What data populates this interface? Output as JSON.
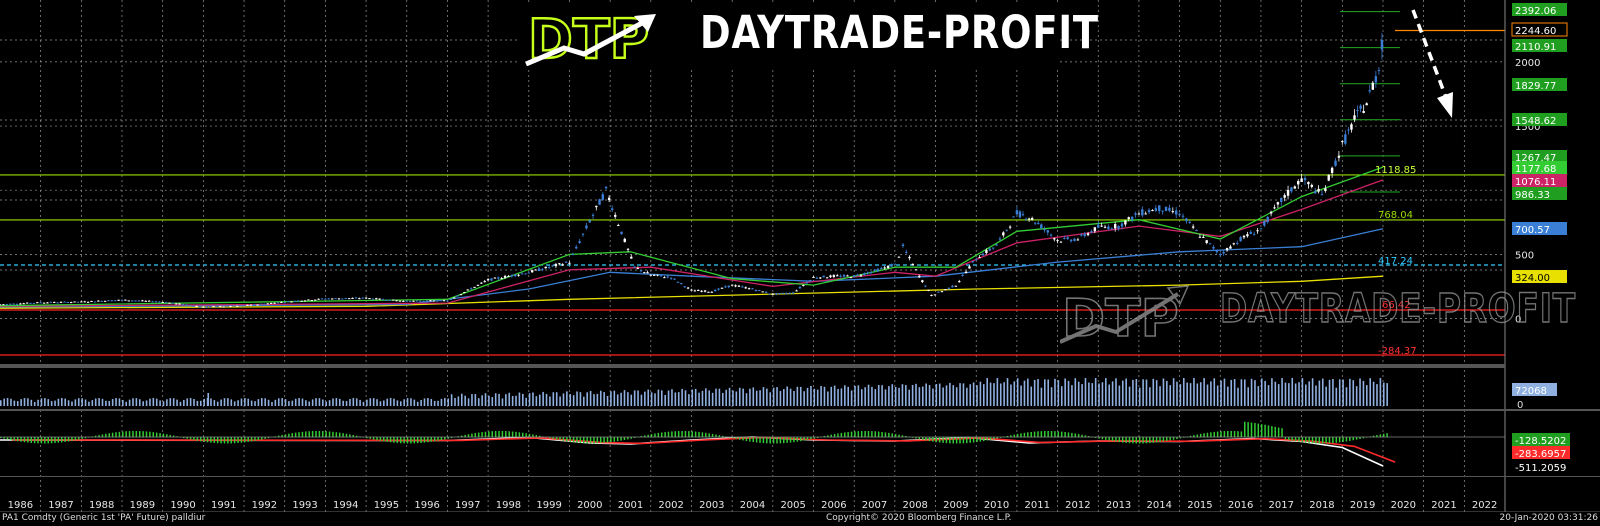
{
  "chart_data": {
    "type": "line",
    "instrument": "PA1 Comdty (Generic 1st 'PA' Future) palldiur",
    "x_ticks": [
      "1986",
      "1987",
      "1988",
      "1989",
      "1990",
      "1991",
      "1992",
      "1993",
      "1994",
      "1995",
      "1996",
      "1997",
      "1998",
      "1999",
      "2000",
      "2001",
      "2002",
      "2003",
      "2004",
      "2005",
      "2006",
      "2007",
      "2008",
      "2009",
      "2010",
      "2011",
      "2012",
      "2013",
      "2014",
      "2015",
      "2016",
      "2017",
      "2018",
      "2019",
      "2020",
      "2021",
      "2022"
    ],
    "y_ticks": [
      {
        "value": 2000,
        "label": "2000"
      },
      {
        "value": 1500,
        "label": "1500"
      },
      {
        "value": 500,
        "label": "500"
      },
      {
        "value": 0,
        "label": "0"
      }
    ],
    "price_series": {
      "name": "Palladium monthly",
      "x": [
        1986,
        1987,
        1988,
        1989,
        1990,
        1991,
        1992,
        1993,
        1994,
        1995,
        1996,
        1997,
        1998,
        1999,
        2000,
        2000.5,
        2000.9,
        2001.2,
        2001.6,
        2002,
        2002.5,
        2003,
        2003.5,
        2004,
        2004.5,
        2005,
        2005.5,
        2006,
        2006.5,
        2007,
        2007.5,
        2008,
        2008.2,
        2008.6,
        2008.9,
        2009.5,
        2010,
        2010.5,
        2011,
        2011.3,
        2011.6,
        2012,
        2012.5,
        2013,
        2013.5,
        2014,
        2014.5,
        2015,
        2015.5,
        2016,
        2016.5,
        2017,
        2017.5,
        2018,
        2018.5,
        2019,
        2019.3,
        2019.6,
        2019.9,
        2020.05
      ],
      "y": [
        110,
        125,
        130,
        145,
        130,
        90,
        100,
        130,
        155,
        160,
        135,
        140,
        300,
        360,
        440,
        760,
        1000,
        740,
        400,
        340,
        320,
        220,
        210,
        260,
        230,
        190,
        200,
        320,
        330,
        330,
        370,
        420,
        560,
        330,
        180,
        260,
        470,
        570,
        820,
        790,
        720,
        610,
        620,
        710,
        720,
        820,
        860,
        820,
        650,
        500,
        620,
        700,
        920,
        1090,
        960,
        1350,
        1550,
        1680,
        1950,
        2350
      ]
    },
    "moving_averages": [
      {
        "name": "MA green",
        "color": "#33cc33",
        "label": "1177.68"
      },
      {
        "name": "MA purple",
        "color": "#cc2266",
        "label": "1076.11"
      },
      {
        "name": "MA blue",
        "color": "#3a7fd5",
        "label": "700.57"
      },
      {
        "name": "MA yellow",
        "color": "#e8e000",
        "label": "324.00"
      }
    ],
    "horizontal_levels": [
      {
        "value": 2392.06,
        "label": "2392.06",
        "color": "#22aa22"
      },
      {
        "value": 2244.6,
        "label": "2244.60",
        "color": "#ff8800"
      },
      {
        "value": 2110.91,
        "label": "2110.91",
        "color": "#22aa22"
      },
      {
        "value": 1829.77,
        "label": "1829.77",
        "color": "#22aa22"
      },
      {
        "value": 1548.62,
        "label": "1548.62",
        "color": "#22aa22"
      },
      {
        "value": 1267.47,
        "label": "1267.47",
        "color": "#22aa22"
      },
      {
        "value": 1118.85,
        "label": "1118.85",
        "color": "#99dd00"
      },
      {
        "value": 986.33,
        "label": "986.33",
        "color": "#22aa22"
      },
      {
        "value": 768.04,
        "label": "768.04",
        "color": "#99dd00"
      },
      {
        "value": 417.24,
        "label": "417.24",
        "color": "#33ccff"
      },
      {
        "value": 66.42,
        "label": "66.42",
        "color": "#ff2222"
      },
      {
        "value": -284.37,
        "label": "-284.37",
        "color": "#ff2222"
      }
    ],
    "volume_panel": {
      "labels": [
        "72068",
        "0"
      ],
      "last_value": 72068
    },
    "macd_panel": {
      "labels": [
        "-128.5202",
        "-283.6957",
        "-511.2059"
      ]
    },
    "annotation": "dashed white arrow pointing down"
  },
  "logo": {
    "mark_text": "DTP",
    "name": "DAYTRADE-PROFIT"
  },
  "footer": {
    "left": "PA1 Comdty (Generic 1st 'PA' Future) palldiur",
    "center": "Copyright© 2020 Bloomberg Finance L.P.",
    "right": "20-Jan-2020 03:31:26"
  },
  "colors": {
    "background": "#000000",
    "grid": "#bbbbbb",
    "price": "#ffffff",
    "down_candle": "#3a7fd5"
  }
}
